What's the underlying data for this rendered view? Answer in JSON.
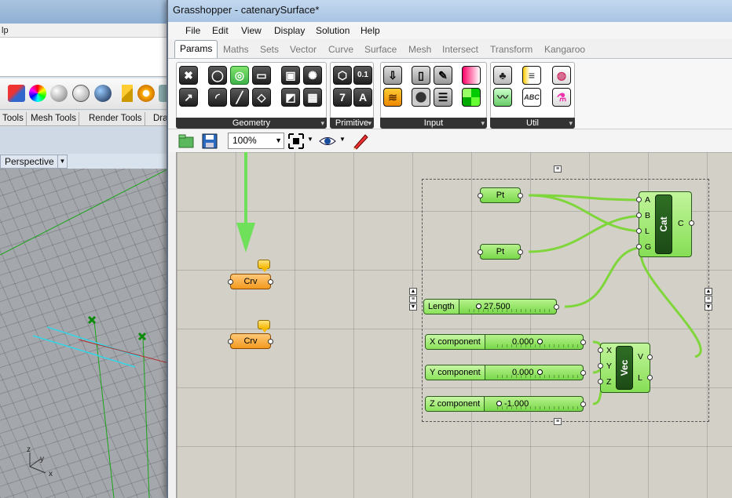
{
  "rhino": {
    "menubar_fragment": "lp",
    "tabs": [
      "Tools",
      "Mesh Tools",
      "Render Tools",
      "Dra"
    ],
    "viewport_name": "Perspective",
    "axis_labels": {
      "z": "z",
      "y": "y",
      "x": "x"
    }
  },
  "grasshopper": {
    "title": "Grasshopper - catenarySurface*",
    "menu": [
      "File",
      "Edit",
      "View",
      "Display",
      "Solution",
      "Help"
    ],
    "tabs": [
      "Params",
      "Maths",
      "Sets",
      "Vector",
      "Curve",
      "Surface",
      "Mesh",
      "Intersect",
      "Transform",
      "Kangaroo"
    ],
    "active_tab": "Params",
    "ribbon_groups": [
      "Geometry",
      "Primitive",
      "Input",
      "Util"
    ],
    "primitive_icons": [
      "0.1",
      "7",
      "A"
    ],
    "zoom": "100%"
  },
  "canvas": {
    "curve_params": [
      {
        "label": "Crv"
      },
      {
        "label": "Crv"
      }
    ],
    "point_params": [
      {
        "label": "Pt"
      },
      {
        "label": "Pt"
      }
    ],
    "length_slider": {
      "label": "Length",
      "value": "27.500"
    },
    "vector_sliders": [
      {
        "label": "X component",
        "value": "0.000"
      },
      {
        "label": "Y component",
        "value": "0.000"
      },
      {
        "label": "Z component",
        "value": "-1.000"
      }
    ],
    "catenary": {
      "name": "Cat",
      "inputs": [
        "A",
        "B",
        "L",
        "G"
      ],
      "outputs": [
        "C"
      ]
    },
    "vector": {
      "name": "Vec",
      "inputs": [
        "X",
        "Y",
        "Z"
      ],
      "outputs": [
        "V",
        "L"
      ]
    }
  },
  "colors": {
    "component_green": "#86de55",
    "param_orange": "#f39a1e",
    "wire_green": "#7fd63a",
    "arrow_green": "#6fe05a"
  },
  "icons": [
    "geometry-icons",
    "save-icon",
    "open-icon",
    "zoom-extents-icon",
    "preview-eye-icon",
    "sketch-icon"
  ]
}
